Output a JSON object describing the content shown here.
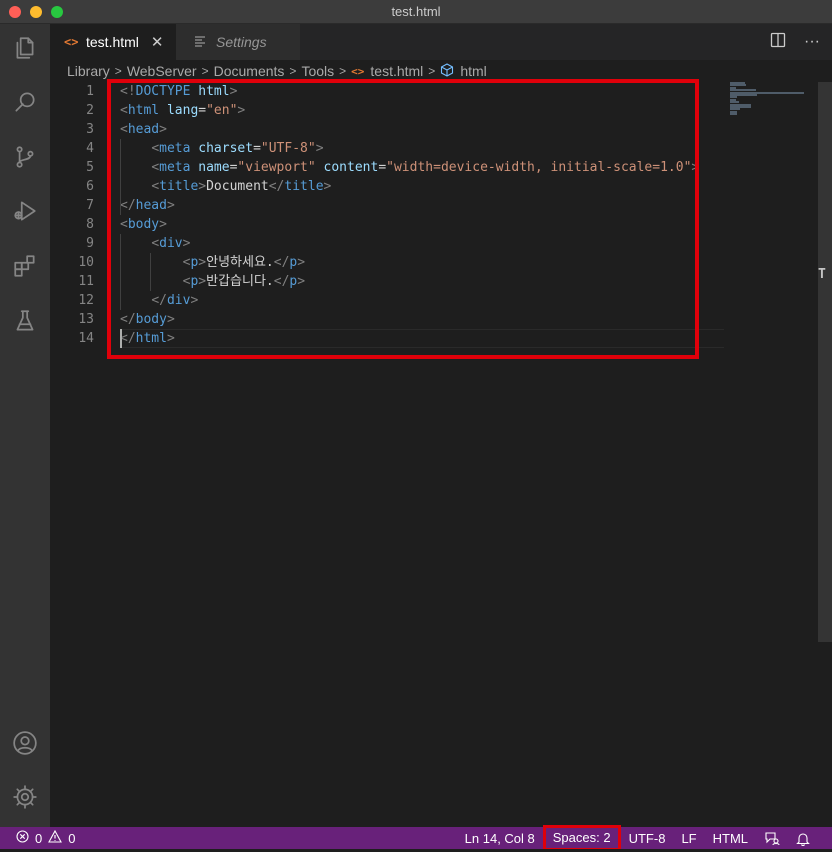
{
  "window": {
    "title": "test.html"
  },
  "activity_bar": {
    "icons": [
      "files-icon",
      "search-icon",
      "source-control-icon",
      "run-debug-icon",
      "extensions-icon",
      "testing-icon",
      "account-icon",
      "gear-icon"
    ]
  },
  "tabs": [
    {
      "label": "test.html",
      "icon": "code-file-icon",
      "active": true,
      "close": "✕"
    },
    {
      "label": "Settings",
      "icon": "settings-list-icon",
      "active": false
    }
  ],
  "tab_actions": {
    "split": "split-editor-icon",
    "more": "···"
  },
  "breadcrumb": {
    "items": [
      "Library",
      "WebServer",
      "Documents",
      "Tools",
      "test.html",
      "html"
    ]
  },
  "editor": {
    "line_numbers": [
      "1",
      "2",
      "3",
      "4",
      "5",
      "6",
      "7",
      "8",
      "9",
      "10",
      "11",
      "12",
      "13",
      "14"
    ],
    "lines": [
      [
        [
          "brk",
          "<!"
        ],
        [
          "tag",
          "DOCTYPE"
        ],
        [
          "attr",
          " html"
        ],
        [
          "brk",
          ">"
        ]
      ],
      [
        [
          "brk",
          "<"
        ],
        [
          "tag",
          "html"
        ],
        [
          "attr",
          " lang"
        ],
        [
          "txt",
          "="
        ],
        [
          "str",
          "\"en\""
        ],
        [
          "brk",
          ">"
        ]
      ],
      [
        [
          "brk",
          "<"
        ],
        [
          "tag",
          "head"
        ],
        [
          "brk",
          ">"
        ]
      ],
      [
        [
          "txt",
          "    "
        ],
        [
          "brk",
          "<"
        ],
        [
          "tag",
          "meta"
        ],
        [
          "attr",
          " charset"
        ],
        [
          "txt",
          "="
        ],
        [
          "str",
          "\"UTF-8\""
        ],
        [
          "brk",
          ">"
        ]
      ],
      [
        [
          "txt",
          "    "
        ],
        [
          "brk",
          "<"
        ],
        [
          "tag",
          "meta"
        ],
        [
          "attr",
          " name"
        ],
        [
          "txt",
          "="
        ],
        [
          "str",
          "\"viewport\""
        ],
        [
          "attr",
          " content"
        ],
        [
          "txt",
          "="
        ],
        [
          "str",
          "\"width=device-width, initial-scale=1.0\""
        ],
        [
          "brk",
          ">"
        ]
      ],
      [
        [
          "txt",
          "    "
        ],
        [
          "brk",
          "<"
        ],
        [
          "tag",
          "title"
        ],
        [
          "brk",
          ">"
        ],
        [
          "txt",
          "Document"
        ],
        [
          "brk",
          "</"
        ],
        [
          "tag",
          "title"
        ],
        [
          "brk",
          ">"
        ]
      ],
      [
        [
          "brk",
          "</"
        ],
        [
          "tag",
          "head"
        ],
        [
          "brk",
          ">"
        ]
      ],
      [
        [
          "brk",
          "<"
        ],
        [
          "tag",
          "body"
        ],
        [
          "brk",
          ">"
        ]
      ],
      [
        [
          "txt",
          "    "
        ],
        [
          "brk",
          "<"
        ],
        [
          "tag",
          "div"
        ],
        [
          "brk",
          ">"
        ]
      ],
      [
        [
          "txt",
          "        "
        ],
        [
          "brk",
          "<"
        ],
        [
          "tag",
          "p"
        ],
        [
          "brk",
          ">"
        ],
        [
          "txt",
          "안녕하세요."
        ],
        [
          "brk",
          "</"
        ],
        [
          "tag",
          "p"
        ],
        [
          "brk",
          ">"
        ]
      ],
      [
        [
          "txt",
          "        "
        ],
        [
          "brk",
          "<"
        ],
        [
          "tag",
          "p"
        ],
        [
          "brk",
          ">"
        ],
        [
          "txt",
          "반갑습니다."
        ],
        [
          "brk",
          "</"
        ],
        [
          "tag",
          "p"
        ],
        [
          "brk",
          ">"
        ]
      ],
      [
        [
          "txt",
          "    "
        ],
        [
          "brk",
          "</"
        ],
        [
          "tag",
          "div"
        ],
        [
          "brk",
          ">"
        ]
      ],
      [
        [
          "brk",
          "</"
        ],
        [
          "tag",
          "body"
        ],
        [
          "brk",
          ">"
        ]
      ],
      [
        [
          "brk",
          "</"
        ],
        [
          "tag",
          "html"
        ],
        [
          "brk",
          ">"
        ]
      ]
    ]
  },
  "statusbar": {
    "errors": "0",
    "warnings": "0",
    "position": "Ln 14, Col 8",
    "spaces": "Spaces: 2",
    "encoding": "UTF-8",
    "eol": "LF",
    "language": "HTML"
  },
  "colors": {
    "status_bar": "#68217a",
    "highlight": "#e0000a",
    "tag": "#569cd6",
    "attribute": "#9cdcfe",
    "string": "#ce9178"
  }
}
